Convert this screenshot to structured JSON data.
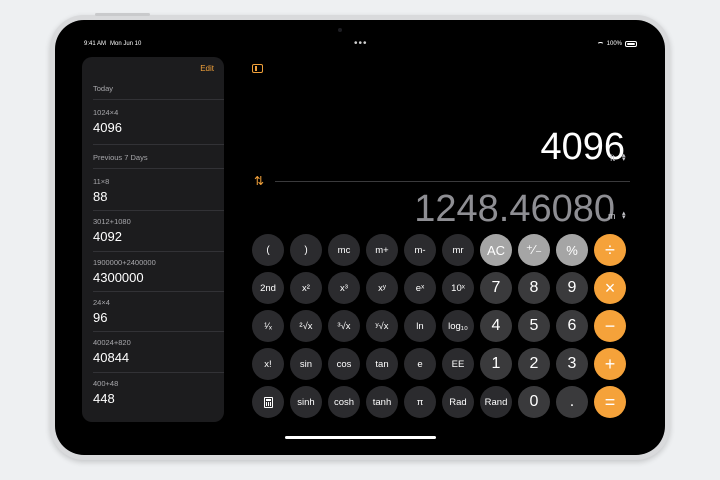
{
  "status": {
    "time": "9:41 AM",
    "date": "Mon Jun 10",
    "battery": "100%"
  },
  "sidebar": {
    "edit_label": "Edit",
    "sections": [
      "Today",
      "Previous 7 Days"
    ],
    "entries": [
      {
        "expr": "1024×4",
        "result": "4096"
      },
      {
        "expr": "11×8",
        "result": "88"
      },
      {
        "expr": "3012+1080",
        "result": "4092"
      },
      {
        "expr": "1900000+2400000",
        "result": "4300000"
      },
      {
        "expr": "24×4",
        "result": "96"
      },
      {
        "expr": "40024+820",
        "result": "40844"
      },
      {
        "expr": "400+48",
        "result": "448"
      }
    ]
  },
  "display": {
    "top_value": "4096",
    "top_unit": "ft",
    "bottom_value": "1248.46080",
    "bottom_unit": "m"
  },
  "keys": {
    "r0": [
      "(",
      ")",
      "mc",
      "m+",
      "m-",
      "mr",
      "AC",
      "⁺∕₋",
      "%",
      "÷"
    ],
    "r1": [
      "2nd",
      "x²",
      "x³",
      "xʸ",
      "eˣ",
      "10ˣ",
      "7",
      "8",
      "9",
      "×"
    ],
    "r2": [
      "¹⁄ₓ",
      "²√x",
      "³√x",
      "ʸ√x",
      "ln",
      "log₁₀",
      "4",
      "5",
      "6",
      "−"
    ],
    "r3": [
      "x!",
      "sin",
      "cos",
      "tan",
      "e",
      "EE",
      "1",
      "2",
      "3",
      "+"
    ],
    "r4": [
      "",
      "sinh",
      "cosh",
      "tanh",
      "π",
      "Rad",
      "Rand",
      "0",
      ".",
      "="
    ]
  }
}
